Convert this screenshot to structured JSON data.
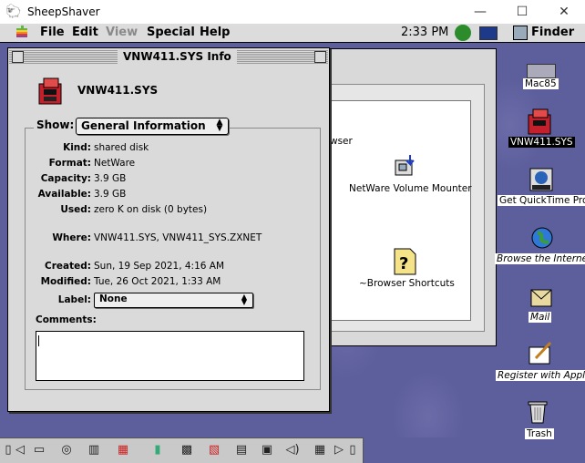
{
  "host": {
    "title": "SheepShaver",
    "icon": "sheep-icon",
    "minimize_glyph": "—",
    "maximize_glyph": "☐",
    "close_glyph": "✕"
  },
  "menubar": {
    "apple_glyph": "",
    "items": [
      "File",
      "Edit",
      "View",
      "Special",
      "Help"
    ],
    "clock": "2:33 PM",
    "app_name": "Finder"
  },
  "info_window": {
    "title": "VNW411.SYS Info",
    "name": "VNW411.SYS",
    "show_label": "Show:",
    "show_value": "General Information",
    "fields": {
      "kind_label": "Kind:",
      "kind": "shared disk",
      "format_label": "Format:",
      "format": "NetWare",
      "capacity_label": "Capacity:",
      "capacity": "3.9 GB",
      "available_label": "Available:",
      "available": "3.9 GB",
      "used_label": "Used:",
      "used": "zero K on disk (0 bytes)",
      "where_label": "Where:",
      "where": "VNW411.SYS, VNW411_SYS.ZXNET",
      "created_label": "Created:",
      "created": "Sun, 19 Sep 2021, 4:16 AM",
      "modified_label": "Modified:",
      "modified": "Tue, 26 Oct 2021, 1:33 AM",
      "label_label": "Label:",
      "label": "None",
      "comments_label": "Comments:"
    }
  },
  "background_window": {
    "partial_text": "wser",
    "item1": "NetWare Volume Mounter",
    "item2": "~Browser Shortcuts"
  },
  "desktop_icons": [
    {
      "label": "Mac85"
    },
    {
      "label": "VNW411.SYS"
    },
    {
      "label": "Get QuickTime Pro"
    },
    {
      "label": "Browse the Internet"
    },
    {
      "label": "Mail"
    },
    {
      "label": "Register with Apple"
    },
    {
      "label": "Trash"
    }
  ]
}
